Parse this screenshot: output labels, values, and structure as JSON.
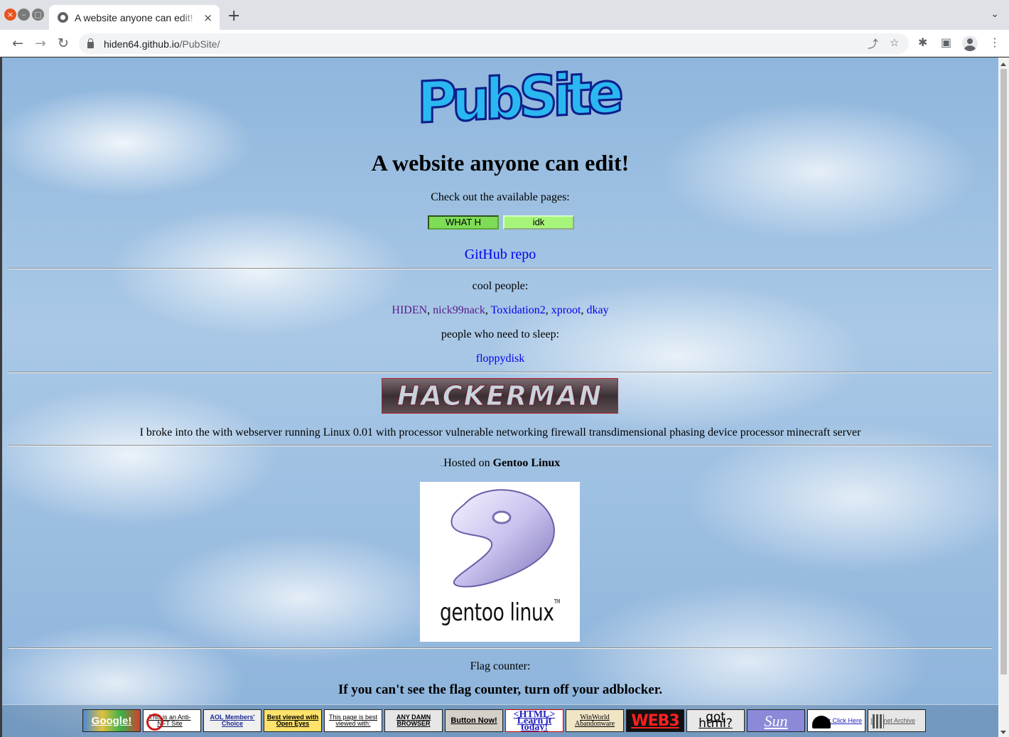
{
  "browser": {
    "tab_title": "A website anyone can edit!",
    "tab_close_icon": "×",
    "new_tab_icon": "+",
    "tab_search_icon": "⌄",
    "url_host": "hiden64.github.io",
    "url_path": "/PubSite/",
    "back_icon": "←",
    "forward_icon": "→",
    "reload_icon": "↻",
    "share_icon": "⤴",
    "bookmark_icon": "☆",
    "extensions_icon": "✱",
    "sidepanel_icon": "▣",
    "menu_icon": "⋮"
  },
  "page": {
    "logo": "PubSite",
    "headline": "A website anyone can edit!",
    "pages_intro": "Check out the available pages:",
    "pages": [
      "WHAT H",
      "idk"
    ],
    "github_link": "GitHub repo",
    "cool_people_label": "cool people:",
    "cool_people": [
      "HIDEN",
      "nick99nack",
      "Toxidation2",
      "xproot",
      "dkay"
    ],
    "sleep_label": "people who need to sleep:",
    "sleepers": [
      "floppydisk"
    ],
    "hacker_banner": "HACKERMAN",
    "hacker_text": "I broke into the with webserver running Linux 0.01 with processor vulnerable networking firewall transdimensional phasing device processor minecraft server",
    "hosted_tiny": "...",
    "hosted_prefix": "Hosted on ",
    "hosted_os": "Gentoo Linux",
    "gentoo_logo_text": "gentoo linux",
    "gentoo_tm": "TM",
    "flag_counter_label": "Flag counter:",
    "flag_counter_warning": "If you can't see the flag counter, turn off your adblocker."
  },
  "badges": [
    {
      "id": "google",
      "text": "Google!"
    },
    {
      "id": "antinft",
      "text": "This is an Anti-NFT Site"
    },
    {
      "id": "aol",
      "text": "AOL Members' Choice"
    },
    {
      "id": "openeyes",
      "text": "Best viewed with Open Eyes"
    },
    {
      "id": "bestviewed",
      "text": "This page is best viewed with:"
    },
    {
      "id": "anydamn",
      "text": "ANY DAMN BROWSER"
    },
    {
      "id": "buttonnow",
      "text": "Button Now!"
    },
    {
      "id": "html",
      "text": "<HTML> Learn it today!"
    },
    {
      "id": "winworld",
      "text": "WinWorld Abandonware"
    },
    {
      "id": "web3",
      "text": "WEB3"
    },
    {
      "id": "gothtml",
      "text": "got html?"
    },
    {
      "id": "sun",
      "text": "Sun"
    },
    {
      "id": "dontclick",
      "text": "Don't Click Here"
    },
    {
      "id": "archive",
      "text": "Internet Archive"
    }
  ]
}
